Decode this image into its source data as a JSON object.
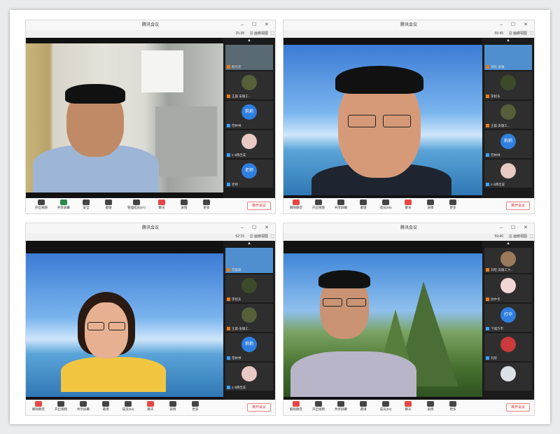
{
  "windows": [
    {
      "title": "腾讯会议",
      "timer": "25:38",
      "gallery_label": "画廊视图",
      "participants": [
        {
          "name": "秋元老",
          "avatar": ""
        },
        {
          "name": "王晨·安徽工...",
          "avatar": ""
        },
        {
          "name": "范林林",
          "avatar": "莉莉"
        },
        {
          "name": "2-3韩佳成",
          "avatar": ""
        },
        {
          "name": "老师",
          "avatar": "老师"
        }
      ],
      "toolbar": [
        "开启视频",
        "共享屏幕",
        "安全",
        "邀请",
        "管理成员(57)",
        "聊天",
        "表情",
        "更多"
      ],
      "leave_label": "离开会议"
    },
    {
      "title": "腾讯会议",
      "timer": "55:45",
      "gallery_label": "画廊视图",
      "participants": [
        {
          "name": "刘旺·安徽",
          "avatar": ""
        },
        {
          "name": "李绍东",
          "avatar": ""
        },
        {
          "name": "王晨·安徽工...",
          "avatar": ""
        },
        {
          "name": "范林林",
          "avatar": "莉莉"
        },
        {
          "name": "2-3韩佳成",
          "avatar": ""
        }
      ],
      "toolbar": [
        "解除静音",
        "开启视频",
        "共享屏幕",
        "邀请",
        "成员(55)",
        "聊天",
        "表情",
        "更多"
      ],
      "leave_label": "离开会议"
    },
    {
      "title": "腾讯会议",
      "timer": "52:15",
      "gallery_label": "画廊视图",
      "participants": [
        {
          "name": "范晨晨",
          "avatar": ""
        },
        {
          "name": "李绍东",
          "avatar": ""
        },
        {
          "name": "王晨·安徽工...",
          "avatar": ""
        },
        {
          "name": "范林林",
          "avatar": "莉莉"
        },
        {
          "name": "2-3韩佳成",
          "avatar": ""
        }
      ],
      "toolbar": [
        "解除静音",
        "开启视频",
        "共享屏幕",
        "邀请",
        "成员(54)",
        "聊天",
        "表情",
        "更多"
      ],
      "leave_label": "离开会议"
    },
    {
      "title": "腾讯会议",
      "timer": "59:40",
      "gallery_label": "画廊视图",
      "participants": [
        {
          "name": "刘旺·安徽工大...",
          "avatar": ""
        },
        {
          "name": "徐中华",
          "avatar": ""
        },
        {
          "name": "下城乃市",
          "avatar": "打伞"
        },
        {
          "name": "刘欣",
          "avatar": ""
        },
        {
          "name": "",
          "avatar": ""
        }
      ],
      "toolbar": [
        "解除静音",
        "开启视频",
        "共享屏幕",
        "邀请",
        "成员(52)",
        "聊天",
        "表情",
        "更多"
      ],
      "leave_label": "离开会议"
    }
  ]
}
